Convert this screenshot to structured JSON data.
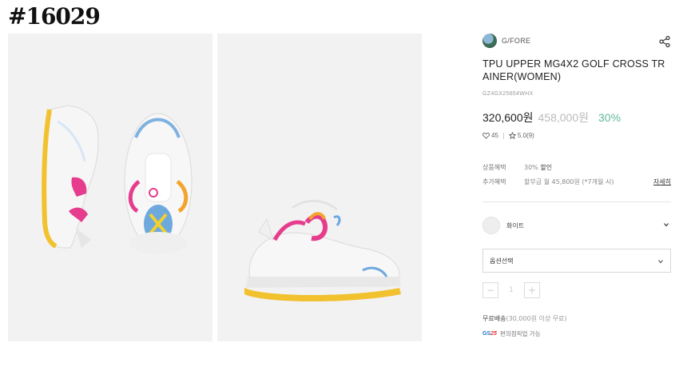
{
  "page_id": "#16029",
  "brand": {
    "name": "G/FORE",
    "logo_icon": "brand-globe-logo"
  },
  "product": {
    "title": "TPU UPPER MG4X2 GOLF CROSS TRAINER(WOMEN)",
    "sku": "GZ4GX25654WHX",
    "price_sale": "320,600원",
    "price_original": "458,000원",
    "discount": "30%",
    "likes": "45",
    "rating": "5.0(9)"
  },
  "benefits": [
    {
      "label": "상품혜택",
      "value_muted": "30%",
      "value": "할인"
    },
    {
      "label": "추가혜택",
      "value": "할부금 월 45,800원 (*7개월 시)",
      "link": "자세히"
    }
  ],
  "color_option": {
    "name": "화이트",
    "swatch": "#eeeeee"
  },
  "option_select": {
    "placeholder": "옵션선택"
  },
  "quantity": {
    "minus": "−",
    "value": "1",
    "plus": "+"
  },
  "shipping": {
    "text": "무료배송",
    "muted": "(30,000원 이상 무료)"
  },
  "pickup": {
    "logo_main": "GS",
    "logo_accent": "25",
    "text": "편의점픽업 가능"
  },
  "colors": {
    "discount_green": "#5fb79a",
    "image_bg": "#f2f2f2"
  }
}
